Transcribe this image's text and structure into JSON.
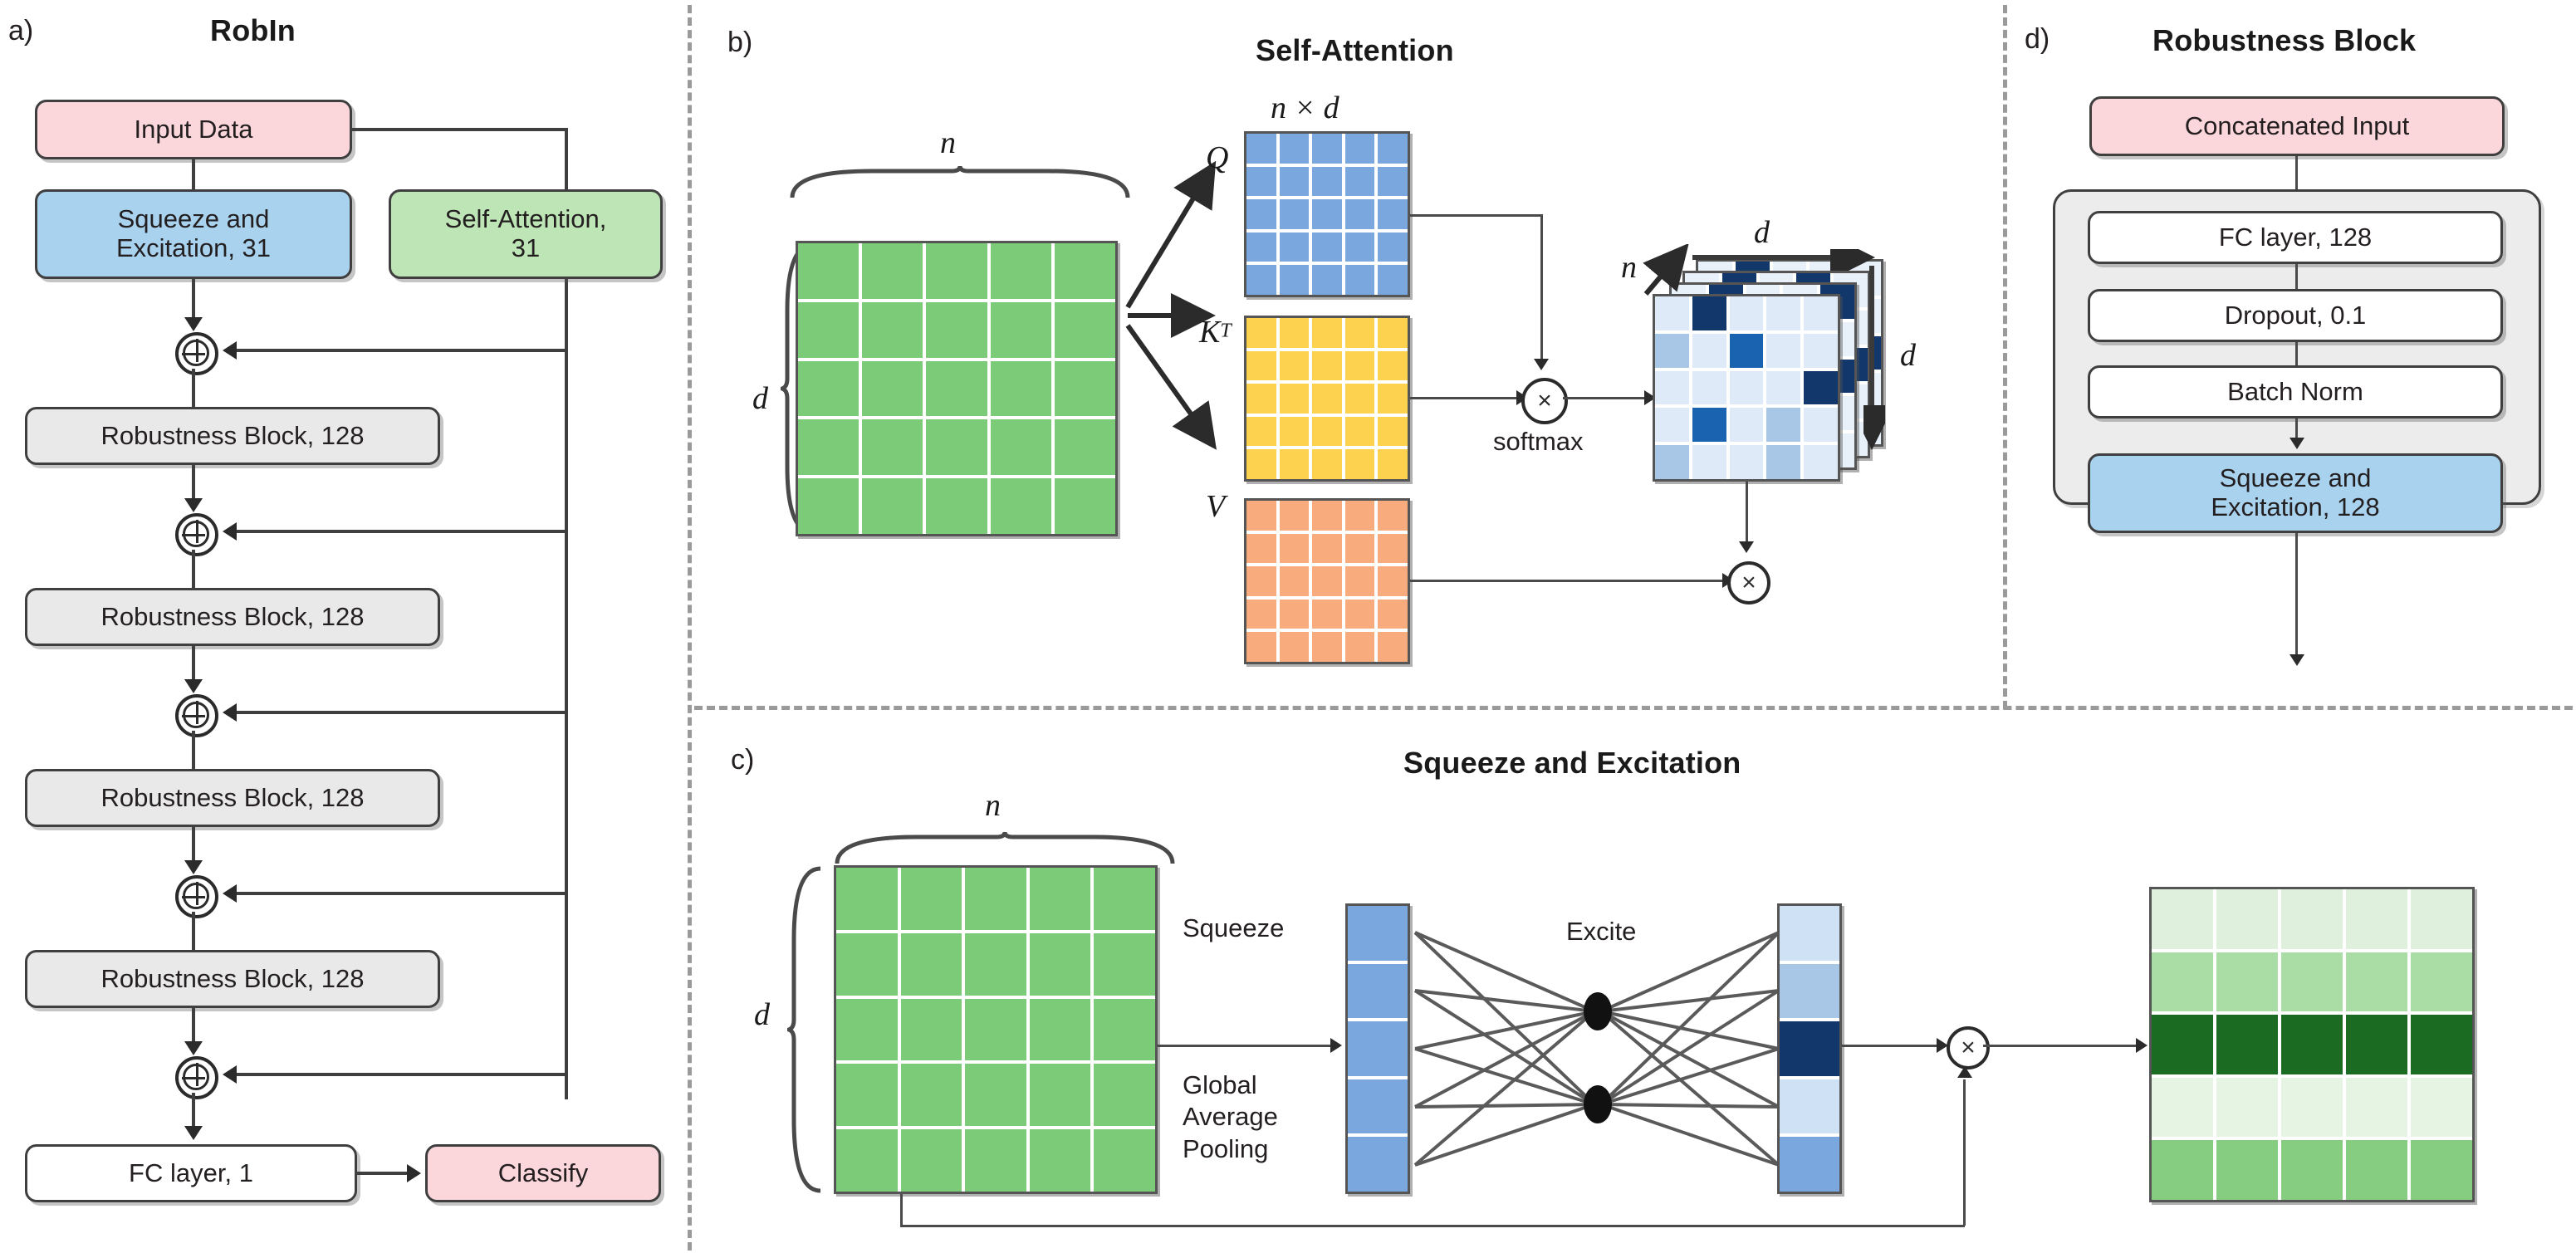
{
  "panels": {
    "a": {
      "letter": "a)",
      "title": "RobIn",
      "nodes": {
        "input": "Input Data",
        "se31": "Squeeze and\nExcitation, 31",
        "sa31": "Self-Attention,\n31",
        "rb1": "Robustness Block, 128",
        "rb2": "Robustness Block, 128",
        "rb3": "Robustness Block, 128",
        "rb4": "Robustness Block, 128",
        "fc1": "FC layer, 1",
        "classify": "Classify"
      },
      "add_symbol": "plus-circle"
    },
    "b": {
      "letter": "b)",
      "title": "Self-Attention",
      "labels": {
        "n": "n",
        "d": "d",
        "nxd": "n × d",
        "Q": "Q",
        "KT": "K",
        "KT_sup": "T",
        "V": "V",
        "softmax": "softmax",
        "stack_n": "n",
        "stack_d_top": "d",
        "stack_d_right": "d",
        "mul_symbol": "×"
      }
    },
    "c": {
      "letter": "c)",
      "title": "Squeeze and Excitation",
      "labels": {
        "n": "n",
        "d": "d",
        "squeeze": "Squeeze",
        "gap": "Global\nAverage\nPooling",
        "excite": "Excite",
        "mul_symbol": "×"
      }
    },
    "d": {
      "letter": "d)",
      "title": "Robustness Block",
      "nodes": {
        "concat": "Concatenated Input",
        "fc128": "FC layer, 128",
        "dropout": "Dropout, 0.1",
        "batchnorm": "Batch Norm",
        "se128": "Squeeze and\nExcitation, 128"
      }
    }
  },
  "colors": {
    "pink": "#fbd7dc",
    "blue": "#a9d2ee",
    "green": "#bde5b5",
    "grey": "#e9e9e9",
    "white": "#ffffff",
    "outline": "#3f3f3f",
    "matrix_green": "#7ccb78",
    "matrix_blue": "#7aa7dd",
    "matrix_yellow": "#fcd24f",
    "matrix_orange": "#f8ab7d",
    "heat_dark": "#11376b",
    "divider": "#9a9a9a"
  },
  "chart_data": {
    "type": "heatmap",
    "title": "Self-Attention attention map (softmax output)",
    "matrices": {
      "input_green": {
        "rows": 5,
        "cols": 5,
        "fill": "#7ccb78"
      },
      "Q": {
        "rows": 5,
        "cols": 5,
        "fill": "#7aa7dd"
      },
      "K_transpose": {
        "rows": 5,
        "cols": 5,
        "fill": "#fcd24f"
      },
      "V": {
        "rows": 5,
        "cols": 5,
        "fill": "#f8ab7d"
      },
      "attention_stack_depth": 4,
      "attention_front": {
        "rows": 5,
        "cols": 5,
        "values": [
          [
            0.12,
            1.0,
            0.1,
            0.1,
            0.12
          ],
          [
            0.45,
            0.1,
            0.85,
            0.12,
            0.12
          ],
          [
            0.15,
            0.12,
            0.12,
            0.12,
            1.0
          ],
          [
            0.12,
            0.85,
            0.1,
            0.42,
            0.12
          ],
          [
            0.45,
            0.1,
            0.12,
            0.45,
            0.15
          ]
        ]
      }
    },
    "se_vectors": {
      "squeeze_vector": {
        "length": 5,
        "values": [
          0.55,
          0.55,
          0.55,
          0.55,
          0.55
        ]
      },
      "excite_vector": {
        "length": 5,
        "values": [
          0.15,
          0.4,
          1.0,
          0.15,
          0.55
        ]
      },
      "hidden_neurons": 2,
      "output_matrix": {
        "rows": 5,
        "cols": 5,
        "row_values": [
          0.12,
          0.42,
          1.0,
          0.1,
          0.52
        ]
      }
    }
  }
}
